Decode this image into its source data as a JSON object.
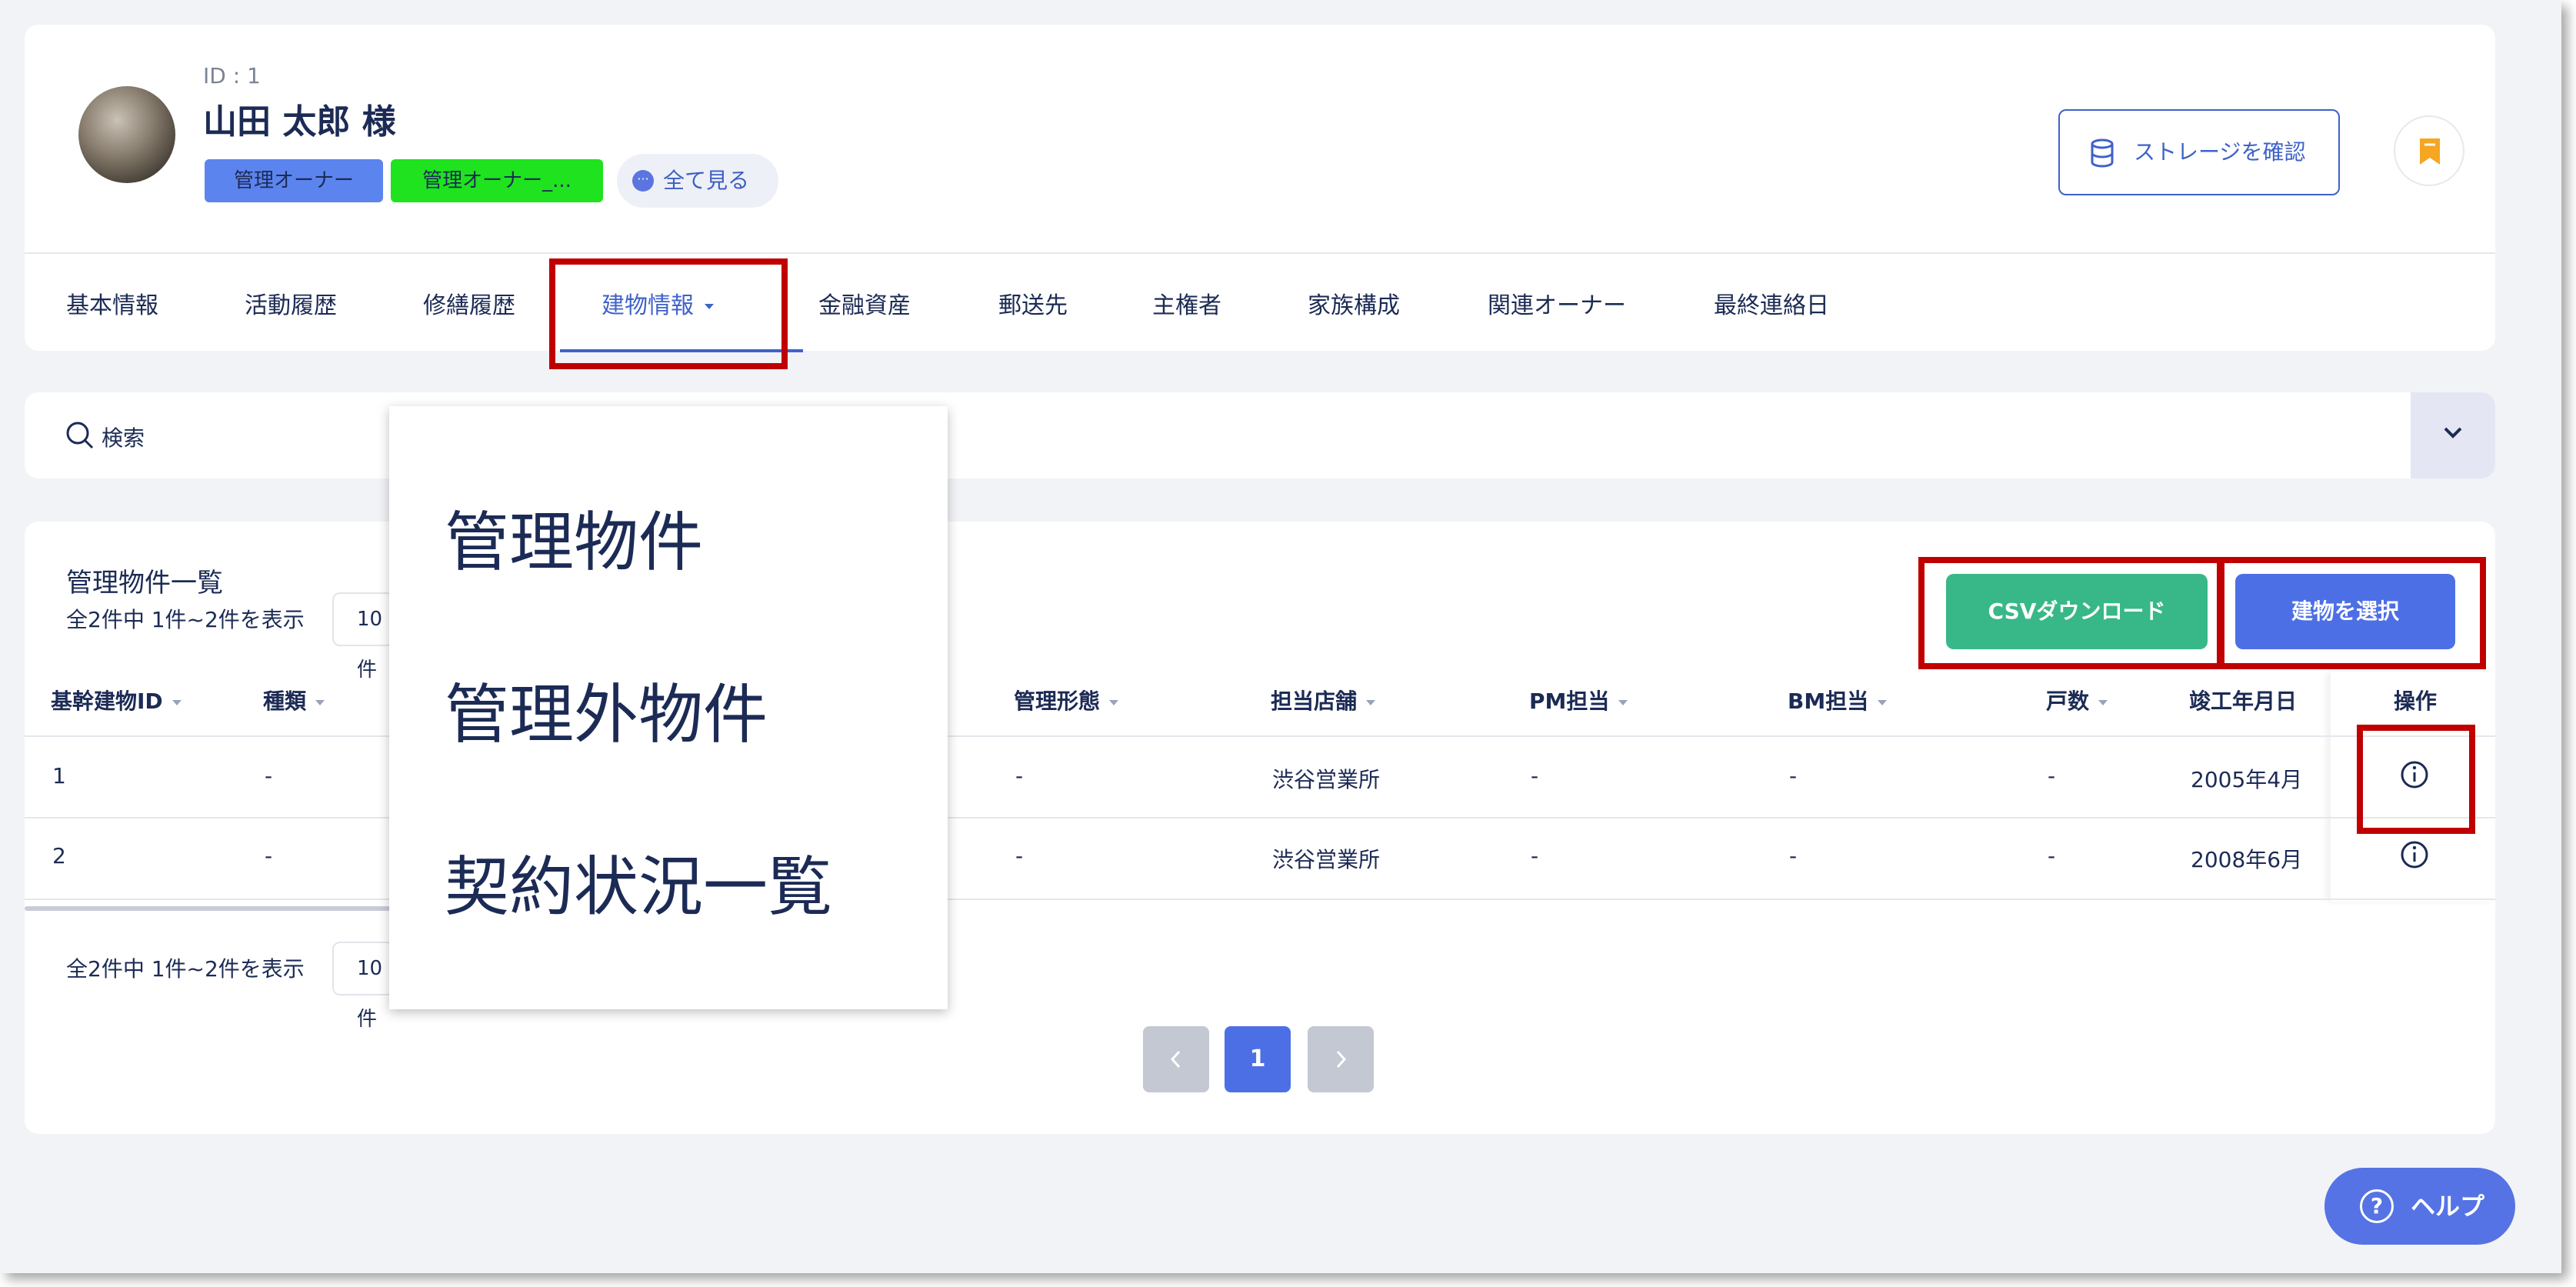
{
  "owner": {
    "id_label": "ID : 1",
    "name": "山田 太郎 様",
    "tags": [
      "管理オーナー",
      "管理オーナー_..."
    ],
    "see_all": "全て見る"
  },
  "header": {
    "storage_button": "ストレージを確認",
    "bookmark_icon": "bookmark-icon"
  },
  "tabs": [
    {
      "label": "基本情報"
    },
    {
      "label": "活動履歴"
    },
    {
      "label": "修繕履歴"
    },
    {
      "label": "建物情報",
      "active": true
    },
    {
      "label": "金融資産"
    },
    {
      "label": "郵送先"
    },
    {
      "label": "主権者"
    },
    {
      "label": "家族構成"
    },
    {
      "label": "関連オーナー"
    },
    {
      "label": "最終連絡日"
    }
  ],
  "search": {
    "label": "検索"
  },
  "list": {
    "title": "管理物件一覧",
    "count_text": "全2件中 1件~2件を表示",
    "per_page": "10件",
    "csv_button": "CSVダウンロード",
    "select_button": "建物を選択",
    "columns": [
      "基幹建物ID",
      "種類",
      "管理形態",
      "担当店舗",
      "PM担当",
      "BM担当",
      "戸数",
      "竣工年月日",
      "操作"
    ],
    "rows": [
      {
        "id": "1",
        "type": "-",
        "mgmt": "-",
        "store": "渋谷営業所",
        "pm": "-",
        "bm": "-",
        "units": "-",
        "built": "2005年4月"
      },
      {
        "id": "2",
        "type": "-",
        "mgmt": "-",
        "store": "渋谷営業所",
        "pm": "-",
        "bm": "-",
        "units": "-",
        "built": "2008年6月"
      }
    ]
  },
  "pagination": {
    "current": "1",
    "prev_icon": "chevron-left-icon",
    "next_icon": "chevron-right-icon"
  },
  "dropdown": {
    "items": [
      "管理物件",
      "管理外物件",
      "契約状況一覧"
    ]
  },
  "help": {
    "label": "ヘルプ"
  },
  "colors": {
    "primary": "#4d6fe6",
    "csv": "#38b889",
    "highlight": "#c00000",
    "tag1": "#5b84ee",
    "tag2": "#1ee31e"
  }
}
